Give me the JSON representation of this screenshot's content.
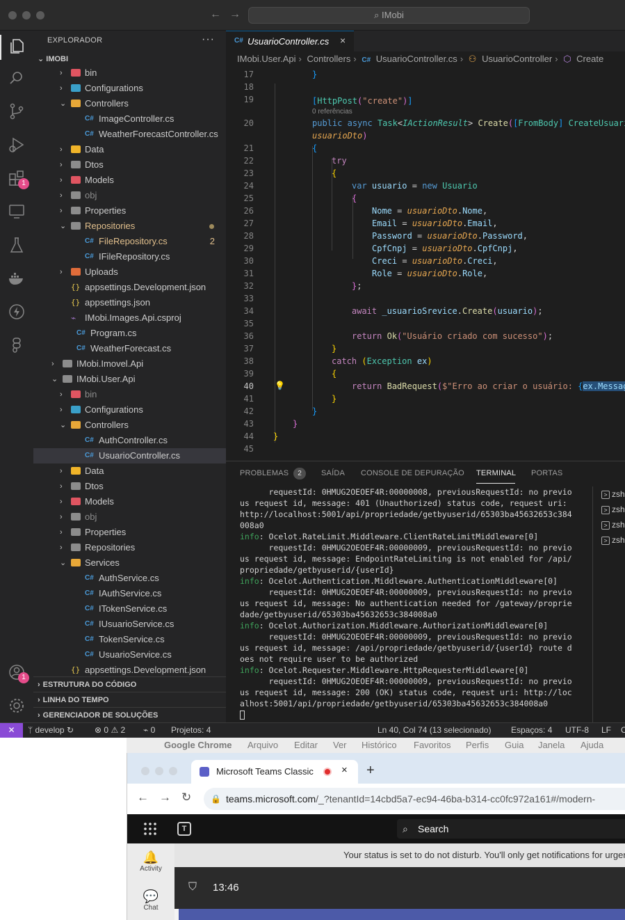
{
  "vscode": {
    "search_placeholder": "IMobi",
    "explorer_title": "EXPLORADOR",
    "more": "···",
    "root": "IMOBI",
    "tree": [
      {
        "label": "bin",
        "kind": "folder",
        "color": "#e05561",
        "indent": 1,
        "chev": "›"
      },
      {
        "label": "Configurations",
        "kind": "folder",
        "color": "#3aa0c9",
        "indent": 1,
        "chev": "›"
      },
      {
        "label": "Controllers",
        "kind": "folder-open",
        "color": "#e8a838",
        "indent": 1,
        "chev": "⌄"
      },
      {
        "label": "ImageController.cs",
        "kind": "cs",
        "indent": 2
      },
      {
        "label": "WeatherForecastController.cs",
        "kind": "cs",
        "indent": 2
      },
      {
        "label": "Data",
        "kind": "folder",
        "color": "#f0b429",
        "indent": 1,
        "chev": "›"
      },
      {
        "label": "Dtos",
        "kind": "folder",
        "color": "#8c8c8c",
        "indent": 1,
        "chev": "›"
      },
      {
        "label": "Models",
        "kind": "folder",
        "color": "#e05561",
        "indent": 1,
        "chev": "›"
      },
      {
        "label": "obj",
        "kind": "folder",
        "color": "#8c8c8c",
        "indent": 1,
        "chev": "›",
        "dim": true
      },
      {
        "label": "Properties",
        "kind": "folder",
        "color": "#8c8c8c",
        "indent": 1,
        "chev": "›"
      },
      {
        "label": "Repositories",
        "kind": "folder-open",
        "color": "#8c8c8c",
        "indent": 1,
        "chev": "⌄",
        "modified": true,
        "orange": true
      },
      {
        "label": "FileRepository.cs",
        "kind": "cs",
        "indent": 2,
        "errors": "2",
        "orange": true
      },
      {
        "label": "IFileRepository.cs",
        "kind": "cs",
        "indent": 2
      },
      {
        "label": "Uploads",
        "kind": "folder",
        "color": "#e06c3a",
        "indent": 1,
        "chev": "›"
      },
      {
        "label": "appsettings.Development.json",
        "kind": "json",
        "indent": 1
      },
      {
        "label": "appsettings.json",
        "kind": "json",
        "indent": 1
      },
      {
        "label": "IMobi.Images.Api.csproj",
        "kind": "proj",
        "indent": 1
      },
      {
        "label": "Program.cs",
        "kind": "cs",
        "indent": 1
      },
      {
        "label": "WeatherForecast.cs",
        "kind": "cs",
        "indent": 1
      },
      {
        "label": "IMobi.Imovel.Api",
        "kind": "folder",
        "color": "#8c8c8c",
        "indent": 0,
        "chev": "›"
      },
      {
        "label": "IMobi.User.Api",
        "kind": "folder",
        "color": "#8c8c8c",
        "indent": 0,
        "chev": "⌄"
      },
      {
        "label": "bin",
        "kind": "folder",
        "color": "#e05561",
        "indent": 1,
        "chev": "›",
        "dim": true
      },
      {
        "label": "Configurations",
        "kind": "folder",
        "color": "#3aa0c9",
        "indent": 1,
        "chev": "›"
      },
      {
        "label": "Controllers",
        "kind": "folder-open",
        "color": "#e8a838",
        "indent": 1,
        "chev": "⌄"
      },
      {
        "label": "AuthController.cs",
        "kind": "cs",
        "indent": 2
      },
      {
        "label": "UsuarioController.cs",
        "kind": "cs",
        "indent": 2,
        "selected": true
      },
      {
        "label": "Data",
        "kind": "folder",
        "color": "#f0b429",
        "indent": 1,
        "chev": "›"
      },
      {
        "label": "Dtos",
        "kind": "folder",
        "color": "#8c8c8c",
        "indent": 1,
        "chev": "›"
      },
      {
        "label": "Models",
        "kind": "folder",
        "color": "#e05561",
        "indent": 1,
        "chev": "›"
      },
      {
        "label": "obj",
        "kind": "folder",
        "color": "#8c8c8c",
        "indent": 1,
        "chev": "›",
        "dim": true
      },
      {
        "label": "Properties",
        "kind": "folder",
        "color": "#8c8c8c",
        "indent": 1,
        "chev": "›"
      },
      {
        "label": "Repositories",
        "kind": "folder",
        "color": "#8c8c8c",
        "indent": 1,
        "chev": "›"
      },
      {
        "label": "Services",
        "kind": "folder-open",
        "color": "#e8a838",
        "indent": 1,
        "chev": "⌄"
      },
      {
        "label": "AuthService.cs",
        "kind": "cs",
        "indent": 2
      },
      {
        "label": "IAuthService.cs",
        "kind": "cs",
        "indent": 2
      },
      {
        "label": "ITokenService.cs",
        "kind": "cs",
        "indent": 2
      },
      {
        "label": "IUsuarioService.cs",
        "kind": "cs",
        "indent": 2
      },
      {
        "label": "TokenService.cs",
        "kind": "cs",
        "indent": 2
      },
      {
        "label": "UsuarioService.cs",
        "kind": "cs",
        "indent": 2
      },
      {
        "label": "appsettings.Development.json",
        "kind": "json",
        "indent": 1
      }
    ],
    "sections": [
      "ESTRUTURA DO CÓDIGO",
      "LINHA DO TEMPO",
      "GERENCIADOR DE SOLUÇÕES"
    ],
    "tab": {
      "icon": "C#",
      "label": "UsuarioController.cs",
      "close": "×"
    },
    "breadcrumb": [
      "IMobi.User.Api",
      "Controllers",
      "UsuarioController.cs",
      "UsuarioController",
      "Create"
    ],
    "breadcrumb_cs": "C#",
    "codelens": "0 referências",
    "line_numbers": [
      "17",
      "18",
      "19",
      "20",
      "21",
      "22",
      "23",
      "24",
      "25",
      "26",
      "27",
      "28",
      "29",
      "30",
      "31",
      "32",
      "33",
      "34",
      "35",
      "36",
      "37",
      "38",
      "39",
      "40",
      "41",
      "42",
      "43",
      "44",
      "45"
    ],
    "code_strings": {
      "route": "\"create\"",
      "ok_msg": "\"Usuário criado com sucesso\"",
      "err_msg": "$\"Erro ao criar o usuário: ",
      "ex_message": "ex.Messag"
    },
    "panel_tabs": [
      "PROBLEMAS",
      "SAÍDA",
      "CONSOLE DE DEPURAÇÃO",
      "TERMINAL",
      "PORTAS"
    ],
    "problems_count": "2",
    "terminal_lines": [
      {
        "text": "      requestId: 0HMUG2OEOEF4R:00000008, previousRequestId: no previo"
      },
      {
        "text": "us request id, message: 401 (Unauthorized) status code, request uri:"
      },
      {
        "text": "http://localhost:5001/api/propriedade/getbyuserid/65303ba45632653c384"
      },
      {
        "text": "008a0"
      },
      {
        "prefix": "info",
        "text": ": Ocelot.RateLimit.Middleware.ClientRateLimitMiddleware[0]"
      },
      {
        "text": "      requestId: 0HMUG2OEOEF4R:00000009, previousRequestId: no previo"
      },
      {
        "text": "us request id, message: EndpointRateLimiting is not enabled for /api/"
      },
      {
        "text": "propriedade/getbyuserid/{userId}"
      },
      {
        "prefix": "info",
        "text": ": Ocelot.Authentication.Middleware.AuthenticationMiddleware[0]"
      },
      {
        "text": "      requestId: 0HMUG2OEOEF4R:00000009, previousRequestId: no previo"
      },
      {
        "text": "us request id, message: No authentication needed for /gateway/proprie"
      },
      {
        "text": "dade/getbyuserid/65303ba45632653c384008a0"
      },
      {
        "prefix": "info",
        "text": ": Ocelot.Authorization.Middleware.AuthorizationMiddleware[0]"
      },
      {
        "text": "      requestId: 0HMUG2OEOEF4R:00000009, previousRequestId: no previo"
      },
      {
        "text": "us request id, message: /api/propriedade/getbyuserid/{userId} route d"
      },
      {
        "text": "oes not require user to be authorized"
      },
      {
        "prefix": "info",
        "text": ": Ocelot.Requester.Middleware.HttpRequesterMiddleware[0]"
      },
      {
        "text": "      requestId: 0HMUG2OEOEF4R:00000009, previousRequestId: no previo"
      },
      {
        "text": "us request id, message: 200 (OK) status code, request uri: http://loc"
      },
      {
        "text": "alhost:5001/api/propriedade/getbyuserid/65303ba45632653c384008a0"
      }
    ],
    "terminal_shells": [
      "zsh",
      "zsh",
      "zsh",
      "zsh"
    ],
    "status": {
      "remote": "✕",
      "branch": "develop",
      "sync": "↻",
      "errors": "0",
      "warnings": "2",
      "ports": "0",
      "projects": "Projetos: 4",
      "cursor": "Ln 40, Col 74 (13 selecionado)",
      "spaces": "Espaços: 4",
      "encoding": "UTF-8",
      "eol": "LF",
      "lang": "C"
    }
  },
  "mac_menu": [
    "Google Chrome",
    "Arquivo",
    "Editar",
    "Ver",
    "Histórico",
    "Favoritos",
    "Perfis",
    "Guia",
    "Janela",
    "Ajuda"
  ],
  "chrome": {
    "tab_title": "Microsoft Teams Classic",
    "tab_close": "×",
    "new_tab": "+",
    "url_host": "teams.microsoft.com",
    "url_rest": "/_?tenantId=14cbd5a7-ec94-46ba-b314-cc0fc972a161#/modern-"
  },
  "teams": {
    "search": "Search",
    "rail": [
      {
        "icon": "🔔",
        "label": "Activity"
      },
      {
        "icon": "💬",
        "label": "Chat"
      }
    ],
    "dnd_text": "Your status is set to do not disturb. You'll only get notifications for urgen",
    "time": "13:46"
  },
  "colors": {
    "accent": "#0e639c",
    "remote": "#8a4bd6",
    "teams": "#5b5fc7"
  }
}
